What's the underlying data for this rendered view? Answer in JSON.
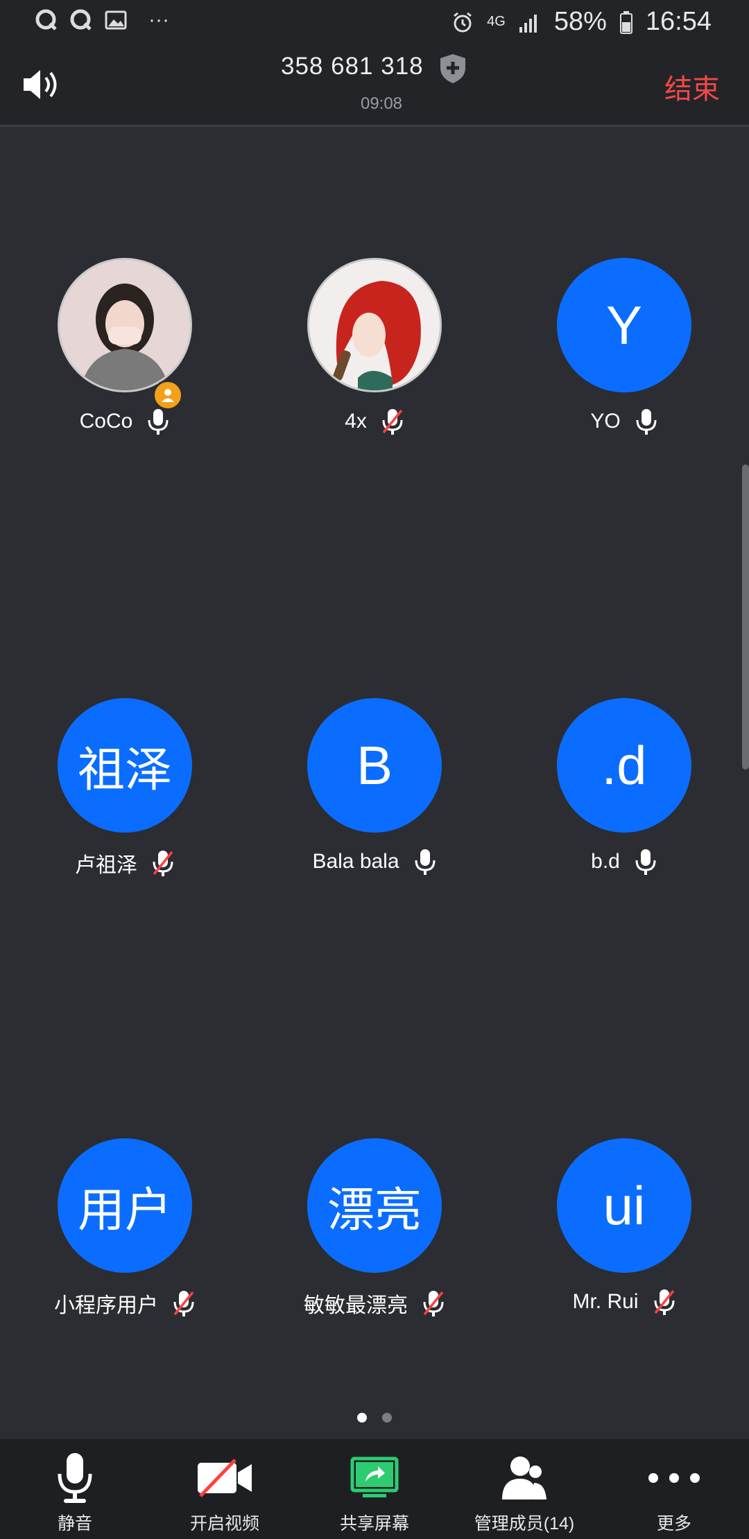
{
  "status_bar": {
    "battery": "58%",
    "time": "16:54",
    "network": "4G",
    "more_dots": "···"
  },
  "header": {
    "meeting_id": "358 681 318",
    "elapsed": "09:08",
    "end_label": "结束"
  },
  "participants": [
    {
      "name": "CoCo",
      "avatar_text": "",
      "avatar_type": "photo",
      "muted": false,
      "host": true
    },
    {
      "name": "4x",
      "avatar_text": "",
      "avatar_type": "photo",
      "muted": true,
      "host": false
    },
    {
      "name": "YO",
      "avatar_text": "Y",
      "avatar_type": "initial",
      "muted": false,
      "host": false
    },
    {
      "name": "卢祖泽",
      "avatar_text": "祖泽",
      "avatar_type": "initial",
      "muted": true,
      "host": false
    },
    {
      "name": "Bala bala",
      "avatar_text": "B",
      "avatar_type": "initial",
      "muted": false,
      "host": false
    },
    {
      "name": "b.d",
      "avatar_text": ".d",
      "avatar_type": "initial",
      "muted": false,
      "host": false
    },
    {
      "name": "小程序用户",
      "avatar_text": "用户",
      "avatar_type": "initial",
      "muted": true,
      "host": false
    },
    {
      "name": "敏敏最漂亮",
      "avatar_text": "漂亮",
      "avatar_type": "initial",
      "muted": true,
      "host": false
    },
    {
      "name": "Mr. Rui",
      "avatar_text": "ui",
      "avatar_type": "initial",
      "muted": true,
      "host": false
    }
  ],
  "pager": {
    "current": 1,
    "total": 2
  },
  "toolbar": {
    "mute_label": "静音",
    "video_label": "开启视频",
    "share_label": "共享屏幕",
    "manage_label": "管理成员(14)",
    "more_label": "更多"
  },
  "colors": {
    "background": "#2b2d32",
    "avatar_blue": "#0a6dff",
    "end_red": "#f04848",
    "share_green": "#2ecc71",
    "muted_red": "#ff4040"
  }
}
